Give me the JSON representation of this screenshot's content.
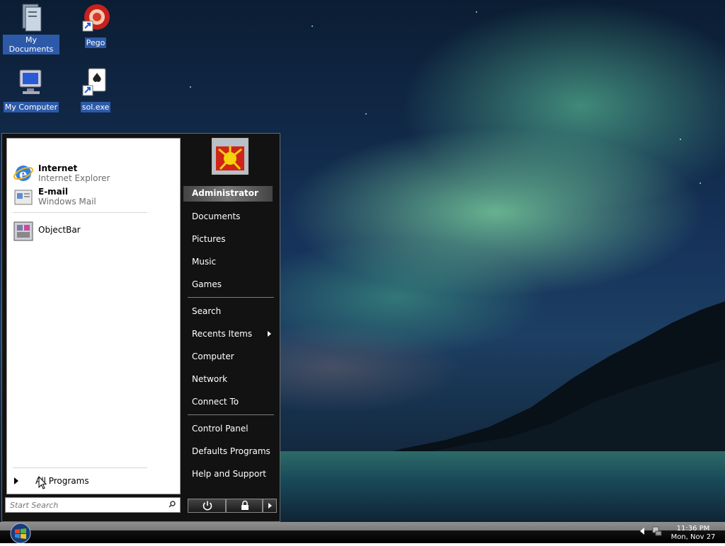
{
  "desktop": {
    "icons": [
      {
        "label": "My Documents"
      },
      {
        "label": "Pego"
      },
      {
        "label": "My Computer"
      },
      {
        "label": "sol.exe"
      }
    ]
  },
  "start_menu": {
    "pinned": [
      {
        "title": "Internet",
        "subtitle": "Internet Explorer",
        "icon": "internet-explorer-icon"
      },
      {
        "title": "E-mail",
        "subtitle": "Windows Mail",
        "icon": "mail-icon"
      }
    ],
    "recent": [
      {
        "title": "ObjectBar",
        "icon": "objectbar-icon"
      }
    ],
    "all_programs_label": "All Programs",
    "search_placeholder": "Start Search",
    "user_name": "Administrator",
    "right_items_group1": [
      "Documents",
      "Pictures",
      "Music",
      "Games"
    ],
    "right_items_group2": [
      "Search",
      "Recents Items",
      "Computer",
      "Network",
      "Connect To"
    ],
    "right_items_group3": [
      "Control Panel",
      "Defaults Programs",
      "Help and Support"
    ]
  },
  "taskbar": {
    "time": "11:36 PM",
    "date": "Mon, Nov 27"
  },
  "colors": {
    "menu_bg": "#121212",
    "left_pane_bg": "#ffffff",
    "icon_label_bg": "#2d5aa8",
    "aurora": "#7ed6a0"
  }
}
